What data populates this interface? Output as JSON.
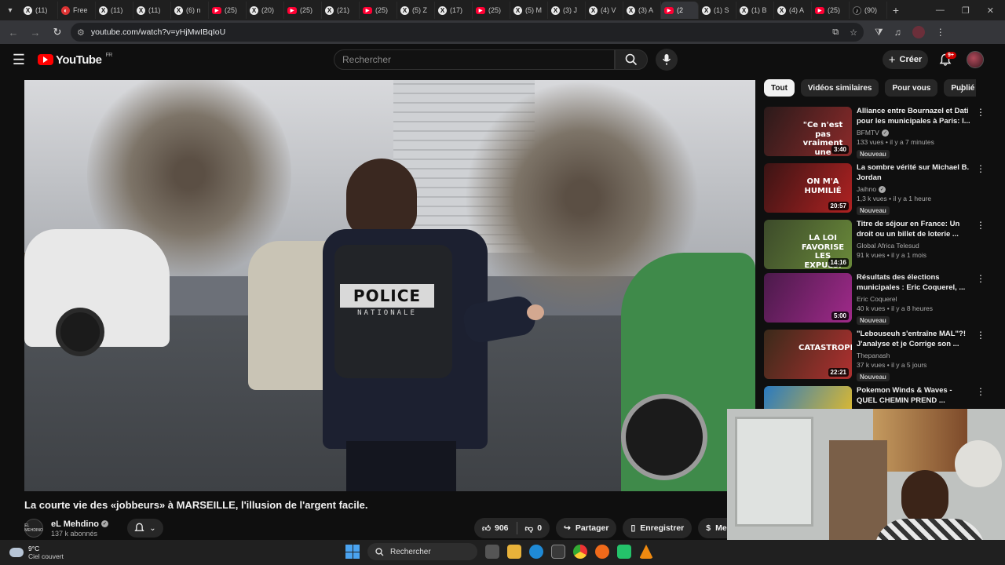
{
  "browser": {
    "tabs": [
      {
        "icon": "x-icon",
        "label": "(11)"
      },
      {
        "icon": "free-icon",
        "label": "Free"
      },
      {
        "icon": "x-icon",
        "label": "(11)"
      },
      {
        "icon": "x-icon",
        "label": "(11)"
      },
      {
        "icon": "x-icon",
        "label": "(6) n"
      },
      {
        "icon": "youtube-icon",
        "label": "(25)"
      },
      {
        "icon": "x-icon",
        "label": "(20)"
      },
      {
        "icon": "youtube-icon",
        "label": "(25)"
      },
      {
        "icon": "x-icon",
        "label": "(21)"
      },
      {
        "icon": "youtube-icon",
        "label": "(25)"
      },
      {
        "icon": "x-icon",
        "label": "(5) Z"
      },
      {
        "icon": "x-icon",
        "label": "(17)"
      },
      {
        "icon": "youtube-icon",
        "label": "(25)"
      },
      {
        "icon": "x-icon",
        "label": "(5) M"
      },
      {
        "icon": "x-icon",
        "label": "(3) J"
      },
      {
        "icon": "x-icon",
        "label": "(4) V"
      },
      {
        "icon": "x-icon",
        "label": "(3) A"
      },
      {
        "icon": "youtube-icon",
        "label": "(2"
      },
      {
        "icon": "x-icon",
        "label": "(1) S"
      },
      {
        "icon": "x-icon",
        "label": "(1) B"
      },
      {
        "icon": "x-icon",
        "label": "(4) A"
      },
      {
        "icon": "youtube-icon",
        "label": "(25)"
      },
      {
        "icon": "tiktok-icon",
        "label": "(90)"
      }
    ],
    "url": "youtube.com/watch?v=yHjMwIBqIoU"
  },
  "youtube": {
    "logo_text": "YouTube",
    "region": "FR",
    "search_placeholder": "Rechercher",
    "create_label": "Créer",
    "notif_count": "9+"
  },
  "video": {
    "vest_label": "POLICE",
    "vest_sub": "NATIONALE",
    "title": "La courte vie des «jobbeurs» à MARSEILLE, l'illusion de l'argent facile.",
    "channel": "eL Mehdino",
    "channel_avatar_text": "EL MEHDINO",
    "subscribers": "137 k abonnés",
    "likes": "906",
    "dislikes": "0",
    "share_label": "Partager",
    "save_label": "Enregistrer",
    "thanks_label": "Merci"
  },
  "chips": [
    "Tout",
    "Vidéos similaires",
    "Pour vous",
    "Publié"
  ],
  "recommendations": [
    {
      "title": "Alliance entre Bournazel et Dati pour les municipales à Paris: l...",
      "channel": "BFMTV",
      "verified": true,
      "stats": "133 vues • il y a 7 minutes",
      "duration": "3:40",
      "badge": "Nouveau",
      "thumb_text": "\"Ce n'est pas vraiment une surprise\"",
      "colors": [
        "#2a1a1a",
        "#8c2a2a"
      ]
    },
    {
      "title": "La sombre vérité sur Michael B. Jordan",
      "channel": "Jaihno",
      "verified": true,
      "stats": "1,3 k vues • il y a 1 heure",
      "duration": "20:57",
      "badge": "Nouveau",
      "thumb_text": "ON M'A HUMILIÉ",
      "colors": [
        "#3a1414",
        "#b02222"
      ]
    },
    {
      "title": "Titre de séjour en France: Un droit ou un billet de loterie ...",
      "channel": "Global Africa Telesud",
      "verified": false,
      "stats": "91 k vues • il y a 1 mois",
      "duration": "14:16",
      "badge": "",
      "thumb_text": "LA LOI FAVORISE LES EXPULSI",
      "colors": [
        "#3c4a2a",
        "#6a8a3a"
      ]
    },
    {
      "title": "Résultats des élections municipales : Eric Coquerel, ...",
      "channel": "Eric Coquerel",
      "verified": false,
      "stats": "40 k vues • il y a 8 heures",
      "duration": "5:00",
      "badge": "Nouveau",
      "thumb_text": "",
      "colors": [
        "#4a1a4a",
        "#a02a8a"
      ]
    },
    {
      "title": "\"Lebouseuh s'entraîne MAL\"?! J'analyse et je Corrige son ...",
      "channel": "Thepanash",
      "verified": false,
      "stats": "37 k vues • il y a 5 jours",
      "duration": "22:21",
      "badge": "Nouveau",
      "thumb_text": "CATASTROPHIQUE",
      "colors": [
        "#3a2a1a",
        "#b03030"
      ]
    },
    {
      "title": "Pokemon Winds & Waves - QUEL CHEMIN PREND ...",
      "channel": "",
      "verified": false,
      "stats": "",
      "duration": "",
      "badge": "",
      "thumb_text": "",
      "colors": [
        "#2a7ac0",
        "#f0c020"
      ]
    }
  ],
  "taskbar": {
    "temperature": "9°C",
    "condition": "Ciel couvert",
    "search_label": "Rechercher"
  }
}
